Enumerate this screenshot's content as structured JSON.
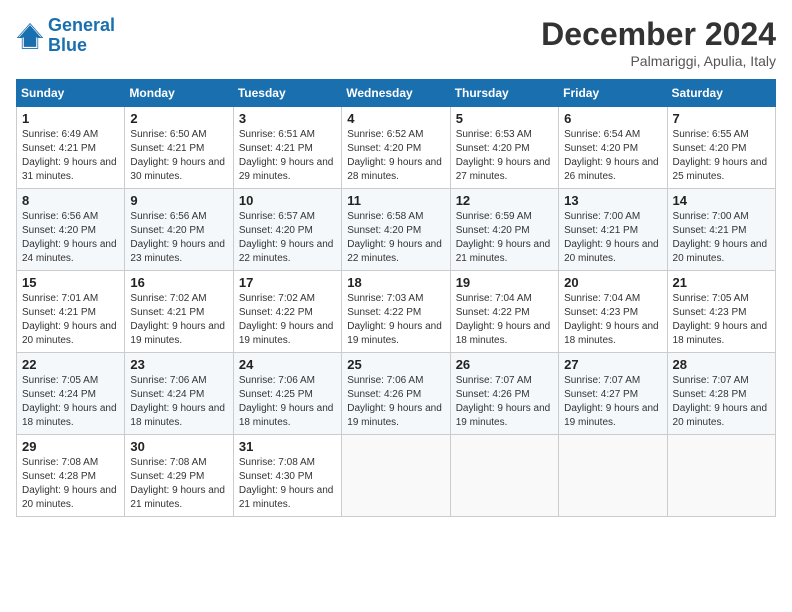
{
  "header": {
    "logo_line1": "General",
    "logo_line2": "Blue",
    "month": "December 2024",
    "location": "Palmariggi, Apulia, Italy"
  },
  "weekdays": [
    "Sunday",
    "Monday",
    "Tuesday",
    "Wednesday",
    "Thursday",
    "Friday",
    "Saturday"
  ],
  "weeks": [
    [
      {
        "day": "1",
        "sunrise": "6:49 AM",
        "sunset": "4:21 PM",
        "daylight": "9 hours and 31 minutes."
      },
      {
        "day": "2",
        "sunrise": "6:50 AM",
        "sunset": "4:21 PM",
        "daylight": "9 hours and 30 minutes."
      },
      {
        "day": "3",
        "sunrise": "6:51 AM",
        "sunset": "4:21 PM",
        "daylight": "9 hours and 29 minutes."
      },
      {
        "day": "4",
        "sunrise": "6:52 AM",
        "sunset": "4:20 PM",
        "daylight": "9 hours and 28 minutes."
      },
      {
        "day": "5",
        "sunrise": "6:53 AM",
        "sunset": "4:20 PM",
        "daylight": "9 hours and 27 minutes."
      },
      {
        "day": "6",
        "sunrise": "6:54 AM",
        "sunset": "4:20 PM",
        "daylight": "9 hours and 26 minutes."
      },
      {
        "day": "7",
        "sunrise": "6:55 AM",
        "sunset": "4:20 PM",
        "daylight": "9 hours and 25 minutes."
      }
    ],
    [
      {
        "day": "8",
        "sunrise": "6:56 AM",
        "sunset": "4:20 PM",
        "daylight": "9 hours and 24 minutes."
      },
      {
        "day": "9",
        "sunrise": "6:56 AM",
        "sunset": "4:20 PM",
        "daylight": "9 hours and 23 minutes."
      },
      {
        "day": "10",
        "sunrise": "6:57 AM",
        "sunset": "4:20 PM",
        "daylight": "9 hours and 22 minutes."
      },
      {
        "day": "11",
        "sunrise": "6:58 AM",
        "sunset": "4:20 PM",
        "daylight": "9 hours and 22 minutes."
      },
      {
        "day": "12",
        "sunrise": "6:59 AM",
        "sunset": "4:20 PM",
        "daylight": "9 hours and 21 minutes."
      },
      {
        "day": "13",
        "sunrise": "7:00 AM",
        "sunset": "4:21 PM",
        "daylight": "9 hours and 20 minutes."
      },
      {
        "day": "14",
        "sunrise": "7:00 AM",
        "sunset": "4:21 PM",
        "daylight": "9 hours and 20 minutes."
      }
    ],
    [
      {
        "day": "15",
        "sunrise": "7:01 AM",
        "sunset": "4:21 PM",
        "daylight": "9 hours and 20 minutes."
      },
      {
        "day": "16",
        "sunrise": "7:02 AM",
        "sunset": "4:21 PM",
        "daylight": "9 hours and 19 minutes."
      },
      {
        "day": "17",
        "sunrise": "7:02 AM",
        "sunset": "4:22 PM",
        "daylight": "9 hours and 19 minutes."
      },
      {
        "day": "18",
        "sunrise": "7:03 AM",
        "sunset": "4:22 PM",
        "daylight": "9 hours and 19 minutes."
      },
      {
        "day": "19",
        "sunrise": "7:04 AM",
        "sunset": "4:22 PM",
        "daylight": "9 hours and 18 minutes."
      },
      {
        "day": "20",
        "sunrise": "7:04 AM",
        "sunset": "4:23 PM",
        "daylight": "9 hours and 18 minutes."
      },
      {
        "day": "21",
        "sunrise": "7:05 AM",
        "sunset": "4:23 PM",
        "daylight": "9 hours and 18 minutes."
      }
    ],
    [
      {
        "day": "22",
        "sunrise": "7:05 AM",
        "sunset": "4:24 PM",
        "daylight": "9 hours and 18 minutes."
      },
      {
        "day": "23",
        "sunrise": "7:06 AM",
        "sunset": "4:24 PM",
        "daylight": "9 hours and 18 minutes."
      },
      {
        "day": "24",
        "sunrise": "7:06 AM",
        "sunset": "4:25 PM",
        "daylight": "9 hours and 18 minutes."
      },
      {
        "day": "25",
        "sunrise": "7:06 AM",
        "sunset": "4:26 PM",
        "daylight": "9 hours and 19 minutes."
      },
      {
        "day": "26",
        "sunrise": "7:07 AM",
        "sunset": "4:26 PM",
        "daylight": "9 hours and 19 minutes."
      },
      {
        "day": "27",
        "sunrise": "7:07 AM",
        "sunset": "4:27 PM",
        "daylight": "9 hours and 19 minutes."
      },
      {
        "day": "28",
        "sunrise": "7:07 AM",
        "sunset": "4:28 PM",
        "daylight": "9 hours and 20 minutes."
      }
    ],
    [
      {
        "day": "29",
        "sunrise": "7:08 AM",
        "sunset": "4:28 PM",
        "daylight": "9 hours and 20 minutes."
      },
      {
        "day": "30",
        "sunrise": "7:08 AM",
        "sunset": "4:29 PM",
        "daylight": "9 hours and 21 minutes."
      },
      {
        "day": "31",
        "sunrise": "7:08 AM",
        "sunset": "4:30 PM",
        "daylight": "9 hours and 21 minutes."
      },
      null,
      null,
      null,
      null
    ]
  ]
}
